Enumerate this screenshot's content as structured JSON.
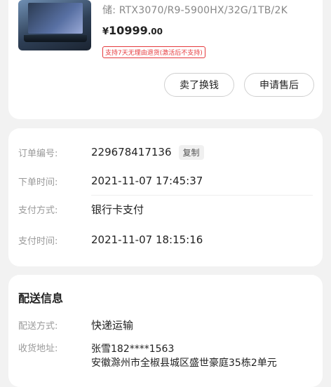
{
  "product": {
    "spec": "储: RTX3070/R9-5900HX/32G/1TB/2K",
    "price_currency": "¥",
    "price_main": "10999",
    "price_cents": ".00",
    "return_policy_badge": "支持7天无理由退货(激活后不支持)",
    "sell_button": "卖了换钱",
    "after_sale_button": "申请售后"
  },
  "order": {
    "rows": [
      {
        "label": "订单编号:",
        "value": "229678417136",
        "action": "复制"
      },
      {
        "label": "下单时间:",
        "value": "2021-11-07 17:45:37"
      },
      {
        "label": "支付方式:",
        "value": "银行卡支付"
      },
      {
        "label": "支付时间:",
        "value": "2021-11-07 18:15:16"
      }
    ]
  },
  "delivery": {
    "title": "配送信息",
    "method_label": "配送方式:",
    "method_value": "快递运输",
    "address_label": "收货地址:",
    "address_name_phone": "张雪182****1563",
    "address_detail": "安徽滁州市全椒县城区盛世豪庭35栋2单元"
  },
  "colors": {
    "page_bg": "#f2f2f2",
    "card_bg": "#ffffff",
    "badge_red": "#e5383b",
    "label_gray": "#9a9a9a"
  }
}
